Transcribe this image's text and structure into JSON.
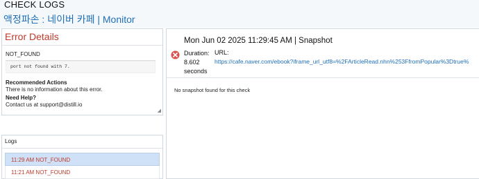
{
  "header": {
    "title": "CHECK LOGS",
    "subtitle": "액정파손 : 네이버 카페 | Monitor"
  },
  "error_panel": {
    "title": "Error Details",
    "code": "NOT_FOUND",
    "message": "port not found with 7.",
    "recommended_heading": "Recommended Actions",
    "recommended_text": "There is no information about this error.",
    "help_heading": "Need Help?",
    "help_text": "Contact us at support@distill.io"
  },
  "logs": {
    "title": "Logs",
    "items": [
      {
        "text": "11:29 AM NOT_FOUND"
      },
      {
        "text": "11:21 AM NOT_FOUND"
      }
    ]
  },
  "snapshot": {
    "title": "Mon Jun 02 2025 11:29:45 AM | Snapshot",
    "duration_label": "Duration:",
    "duration_value": "8.602",
    "duration_unit": "seconds",
    "url_label": "URL:",
    "url": "https://cafe.naver.com/ebook?iframe_url_utf8=%2FArticleRead.nhn%253FfromPopular%3Dtrue%",
    "empty_message": "No snapshot found for this check"
  },
  "colors": {
    "error": "#c0392b",
    "link": "#1e6fb8",
    "selected_log_bg": "#cfe1f6"
  }
}
